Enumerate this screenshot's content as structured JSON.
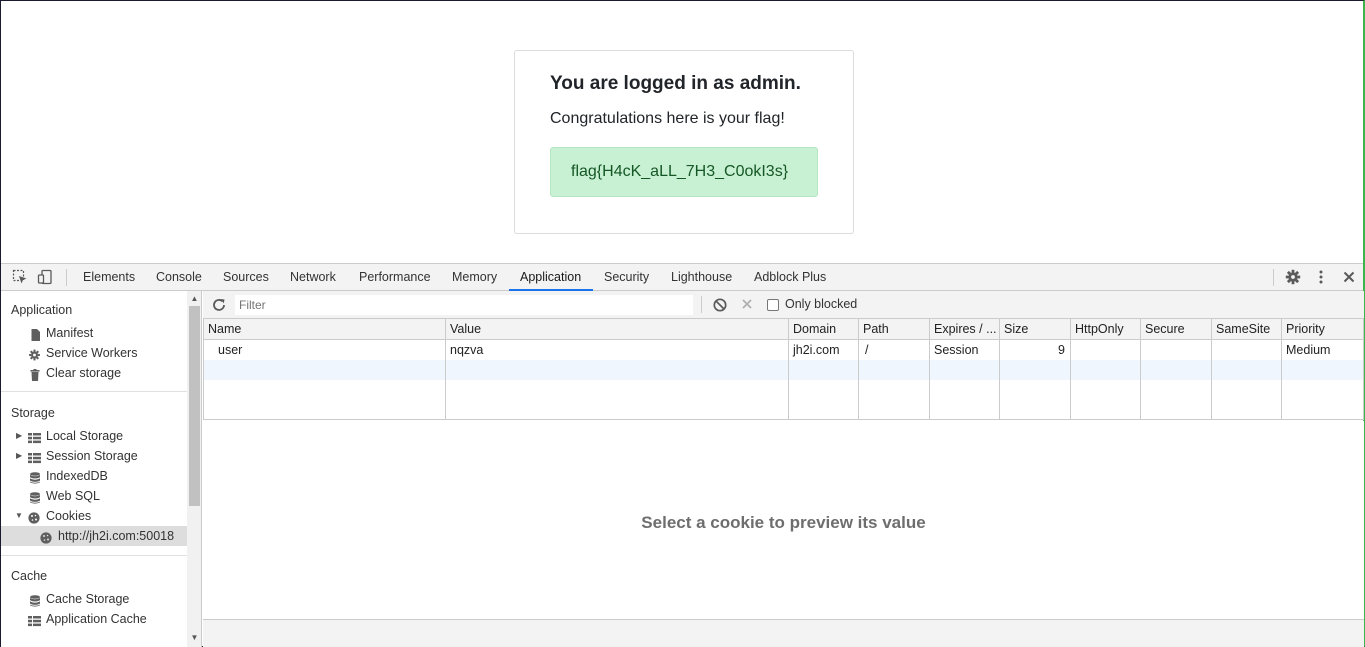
{
  "page": {
    "heading_prefix": "You are logged in as ",
    "heading_user": "admin",
    "heading_suffix": ".",
    "congrats": "Congratulations here is your flag!",
    "flag": "flag{H4cK_aLL_7H3_C0okI3s}"
  },
  "devtools": {
    "tabs": [
      "Elements",
      "Console",
      "Sources",
      "Network",
      "Performance",
      "Memory",
      "Application",
      "Security",
      "Lighthouse",
      "Adblock Plus"
    ],
    "active_tab": "Application",
    "sidebar": {
      "application_section": "Application",
      "application_items": [
        "Manifest",
        "Service Workers",
        "Clear storage"
      ],
      "storage_section": "Storage",
      "storage_items": [
        "Local Storage",
        "Session Storage",
        "IndexedDB",
        "Web SQL",
        "Cookies"
      ],
      "cookie_origin": "http://jh2i.com:50018",
      "cache_section": "Cache",
      "cache_items": [
        "Cache Storage",
        "Application Cache"
      ]
    },
    "filter": {
      "placeholder": "Filter",
      "only_blocked": "Only blocked"
    },
    "table": {
      "columns": [
        "Name",
        "Value",
        "Domain",
        "Path",
        "Expires / ...",
        "Size",
        "HttpOnly",
        "Secure",
        "SameSite",
        "Priority"
      ],
      "rows": [
        {
          "name": "user",
          "value": "nqzva",
          "domain": "jh2i.com",
          "path": "/",
          "expires": "Session",
          "size": "9",
          "httponly": "",
          "secure": "",
          "samesite": "",
          "priority": "Medium"
        }
      ]
    },
    "preview_message": "Select a cookie to preview its value"
  }
}
